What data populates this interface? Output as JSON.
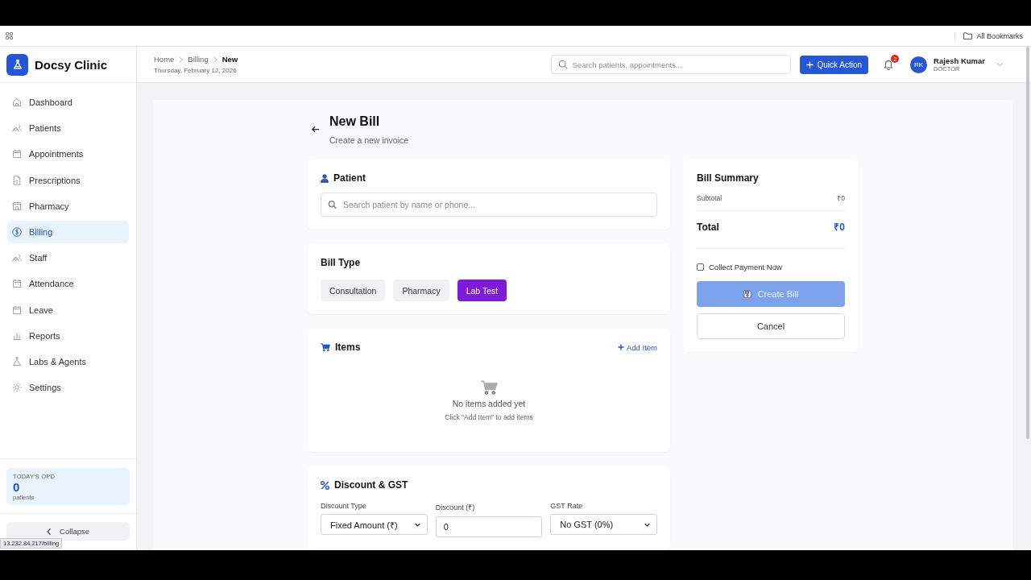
{
  "browser": {
    "bookmarks_label": "All Bookmarks",
    "status_url": "13.232.84.217/billing"
  },
  "sidebar": {
    "brand": "Docsy Clinic",
    "items": [
      {
        "label": "Dashboard",
        "selected": false
      },
      {
        "label": "Patients",
        "selected": false
      },
      {
        "label": "Appointments",
        "selected": false
      },
      {
        "label": "Prescriptions",
        "selected": false
      },
      {
        "label": "Pharmacy",
        "selected": false
      },
      {
        "label": "Billing",
        "selected": true
      },
      {
        "label": "Staff",
        "selected": false
      },
      {
        "label": "Attendance",
        "selected": false
      },
      {
        "label": "Leave",
        "selected": false
      },
      {
        "label": "Reports",
        "selected": false
      },
      {
        "label": "Labs & Agents",
        "selected": false
      },
      {
        "label": "Settings",
        "selected": false
      }
    ],
    "opd": {
      "label": "TODAY'S OPD",
      "count": "0",
      "unit": "patients"
    },
    "collapse": "Collapse"
  },
  "header": {
    "breadcrumbs": [
      {
        "label": "Home",
        "current": false
      },
      {
        "label": "Billing",
        "current": false
      },
      {
        "label": "New",
        "current": true
      }
    ],
    "date": "Thursday, February 12, 2026",
    "search_placeholder": "Search patients, appointments...",
    "quick_action": "Quick Action",
    "notification_count": "2",
    "user": {
      "initials": "RK",
      "name": "Rajesh Kumar",
      "role": "DOCTOR"
    }
  },
  "page": {
    "title": "New Bill",
    "subtitle": "Create a new invoice"
  },
  "patient": {
    "title": "Patient",
    "placeholder": "Search patient by name or phone..."
  },
  "bill_type": {
    "title": "Bill Type",
    "options": [
      {
        "label": "Consultation",
        "selected": false
      },
      {
        "label": "Pharmacy",
        "selected": false
      },
      {
        "label": "Lab Test",
        "selected": true
      }
    ]
  },
  "items": {
    "title": "Items",
    "add": "Add Item",
    "empty_title": "No items added yet",
    "empty_hint": "Click \"Add Item\" to add items"
  },
  "discount": {
    "title": "Discount & GST",
    "fields": [
      {
        "kind": "select",
        "label": "Discount Type",
        "value": "Fixed Amount (₹)"
      },
      {
        "kind": "input",
        "label": "Discount (₹)",
        "value": "0"
      },
      {
        "kind": "select",
        "label": "GST Rate",
        "value": "No GST (0%)"
      }
    ]
  },
  "summary": {
    "title": "Bill Summary",
    "subtotal_label": "Subtotal",
    "subtotal": "₹0",
    "total_label": "Total",
    "total": "₹0",
    "collect_payment": {
      "label": "Collect Payment Now",
      "checked": false
    },
    "create": {
      "label": "Create Bill",
      "disabled": true
    },
    "cancel": "Cancel"
  }
}
